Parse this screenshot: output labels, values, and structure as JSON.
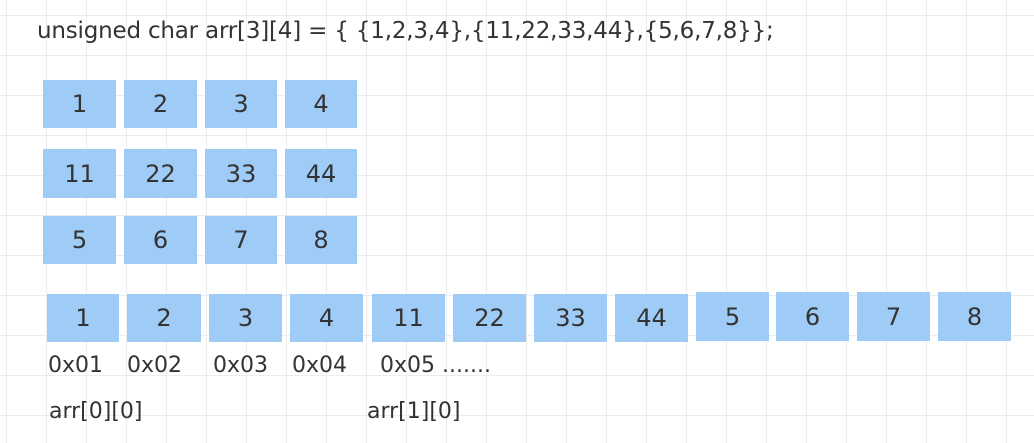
{
  "code_line": "unsigned char arr[3][4] = { {1,2,3,4},{11,22,33,44},{5,6,7,8}};",
  "grid_rows": [
    [
      "1",
      "2",
      "3",
      "4"
    ],
    [
      "11",
      "22",
      "33",
      "44"
    ],
    [
      "5",
      "6",
      "7",
      "8"
    ]
  ],
  "memory_cells": [
    "1",
    "2",
    "3",
    "4",
    "11",
    "22",
    "33",
    "44",
    "5",
    "6",
    "7",
    "8"
  ],
  "addresses": [
    "0x01",
    "0x02",
    "0x03",
    "0x04",
    "0x05 ......."
  ],
  "index_labels": [
    "arr[0][0]",
    "arr[1][0]"
  ],
  "colors": {
    "cell_fill": "#9fcbf7",
    "text": "#333333",
    "grid_line": "#ececec"
  }
}
